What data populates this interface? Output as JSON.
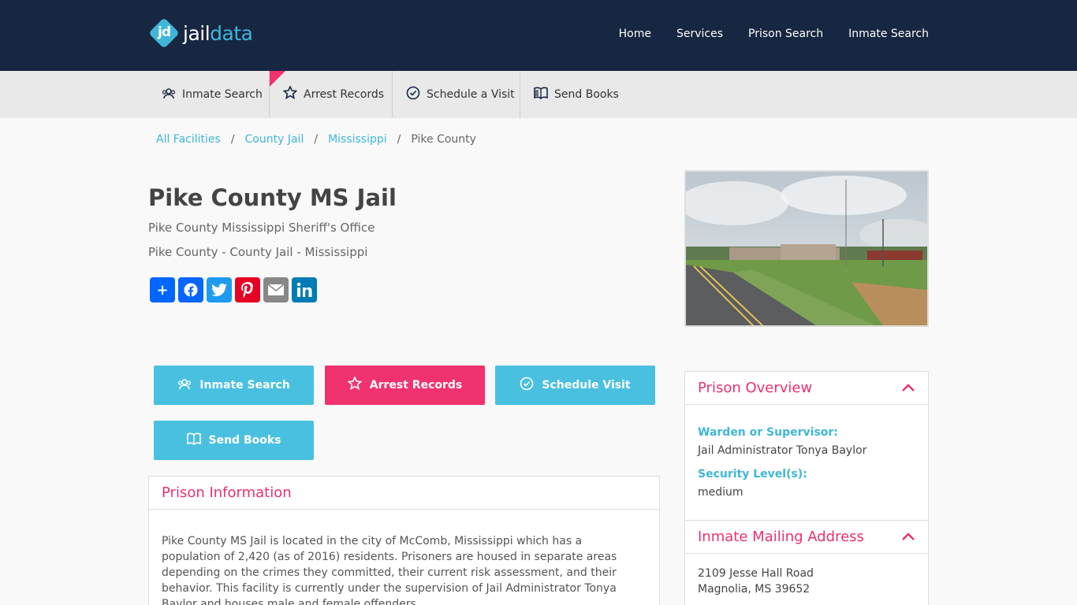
{
  "brand": {
    "logo_mark": "jd",
    "name_part1": "jail",
    "name_part2": "data"
  },
  "main_nav": [
    "Home",
    "Services",
    "Prison Search",
    "Inmate Search"
  ],
  "sub_nav": [
    {
      "label": "Inmate Search",
      "icon": "users-icon"
    },
    {
      "label": "Arrest Records",
      "icon": "star-badge-icon"
    },
    {
      "label": "Schedule a Visit",
      "icon": "clock-icon"
    },
    {
      "label": "Send Books",
      "icon": "book-icon"
    }
  ],
  "breadcrumb": [
    "All Facilities",
    "County Jail",
    "Mississippi",
    "Pike County"
  ],
  "page": {
    "title": "Pike County MS Jail",
    "subtitle": "Pike County Mississippi Sheriff's Office",
    "category": "Pike County - County Jail - Mississippi"
  },
  "share": [
    {
      "name": "share-add-button",
      "glyph": "+",
      "color": "#0166ff"
    },
    {
      "name": "share-facebook-button",
      "glyph": "f",
      "color": "#0866ff"
    },
    {
      "name": "share-twitter-button",
      "glyph": "t",
      "color": "#1d9bf0"
    },
    {
      "name": "share-pinterest-button",
      "glyph": "P",
      "color": "#e60023"
    },
    {
      "name": "share-email-button",
      "glyph": "✉",
      "color": "#888888"
    },
    {
      "name": "share-linkedin-button",
      "glyph": "in",
      "color": "#007bb5"
    }
  ],
  "actions": {
    "inmate_search": "Inmate Search",
    "arrest_records": "Arrest Records",
    "schedule_visit": "Schedule Visit",
    "send_books": "Send Books"
  },
  "prison_info": {
    "heading": "Prison Information",
    "body": "Pike County MS Jail is located in the city of McComb, Mississippi which has a population of 2,420 (as of 2016) residents. Prisoners are housed in separate areas depending on the crimes they committed, their current risk assessment, and their behavior. This facility is currently under the supervision of Jail Administrator Tonya Baylor and houses male and female offenders."
  },
  "overview": {
    "heading": "Prison Overview",
    "warden_label": "Warden or Supervisor:",
    "warden_value": "Jail Administrator Tonya Baylor",
    "security_label": "Security Level(s):",
    "security_value": "medium"
  },
  "mailing": {
    "heading": "Inmate Mailing Address",
    "line1": "2109 Jesse Hall Road",
    "line2": "Magnolia, MS 39652"
  },
  "colors": {
    "navy": "#172641",
    "cyan": "#3eb6d9",
    "pink": "#f0326e"
  }
}
